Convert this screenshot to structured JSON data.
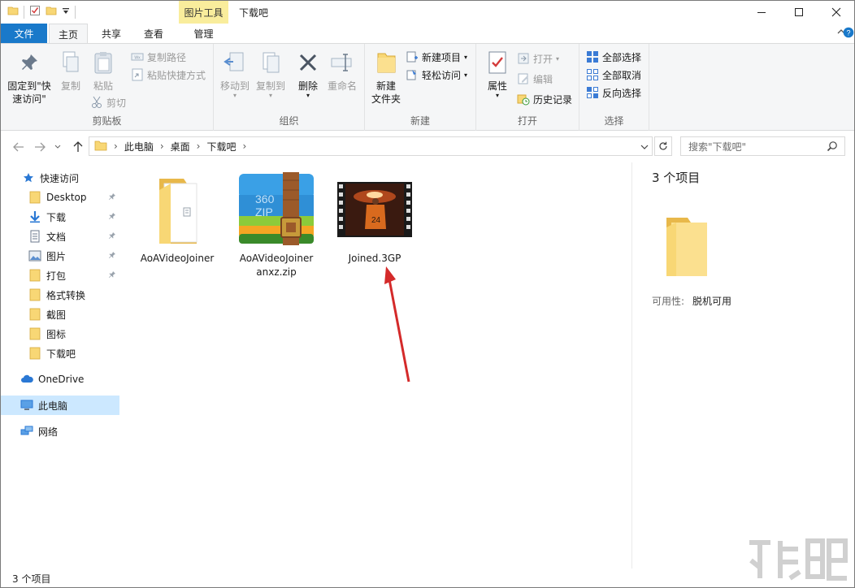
{
  "window": {
    "title": "下载吧",
    "context_group": "图片工具",
    "controls": {
      "minimize": "—",
      "maximize": "☐",
      "close": "✕"
    }
  },
  "tabs": {
    "file": "文件",
    "home": "主页",
    "share": "共享",
    "view": "查看",
    "manage": "管理"
  },
  "ribbon": {
    "clipboard": {
      "label": "剪贴板",
      "pin": "固定到\"快\n速访问\"",
      "copy": "复制",
      "paste": "粘贴",
      "copy_path": "复制路径",
      "paste_shortcut": "粘贴快捷方式",
      "cut": "剪切"
    },
    "organize": {
      "label": "组织",
      "move_to": "移动到",
      "copy_to": "复制到",
      "delete": "删除",
      "rename": "重命名"
    },
    "new": {
      "label": "新建",
      "new_folder": "新建\n文件夹",
      "new_item": "新建项目",
      "easy_access": "轻松访问"
    },
    "open": {
      "label": "打开",
      "properties": "属性",
      "open": "打开",
      "edit": "编辑",
      "history": "历史记录"
    },
    "select": {
      "label": "选择",
      "select_all": "全部选择",
      "select_none": "全部取消",
      "invert": "反向选择"
    }
  },
  "address": {
    "crumbs": [
      "此电脑",
      "桌面",
      "下载吧"
    ],
    "search_placeholder": "搜索\"下载吧\""
  },
  "nav": {
    "quick_access": "快速访问",
    "items": [
      {
        "label": "Desktop",
        "icon": "folder-icon",
        "pinned": true
      },
      {
        "label": "下载",
        "icon": "download-icon",
        "pinned": true
      },
      {
        "label": "文档",
        "icon": "document-icon",
        "pinned": true
      },
      {
        "label": "图片",
        "icon": "picture-icon",
        "pinned": true
      },
      {
        "label": "打包",
        "icon": "folder-icon",
        "pinned": true
      },
      {
        "label": "格式转换",
        "icon": "folder-icon",
        "pinned": false
      },
      {
        "label": "截图",
        "icon": "folder-icon",
        "pinned": false
      },
      {
        "label": "图标",
        "icon": "folder-icon",
        "pinned": false
      },
      {
        "label": "下载吧",
        "icon": "folder-icon",
        "pinned": false
      }
    ],
    "onedrive": "OneDrive",
    "this_pc": "此电脑",
    "network": "网络"
  },
  "files": [
    {
      "name": "AoAVideoJoiner",
      "type": "folder"
    },
    {
      "name": "AoAVideoJoiner\nanxz.zip",
      "type": "zip-archive"
    },
    {
      "name": "Joined.3GP",
      "type": "video"
    }
  ],
  "details": {
    "count": "3 个项目",
    "availability_label": "可用性:",
    "availability_value": "脱机可用"
  },
  "status": {
    "count": "3 个项目"
  },
  "colors": {
    "accent": "#1979ca",
    "context_tab": "#f9ed9c",
    "selection": "#cce8ff",
    "folder": "#f8d775",
    "arrow": "#d42a2a"
  }
}
